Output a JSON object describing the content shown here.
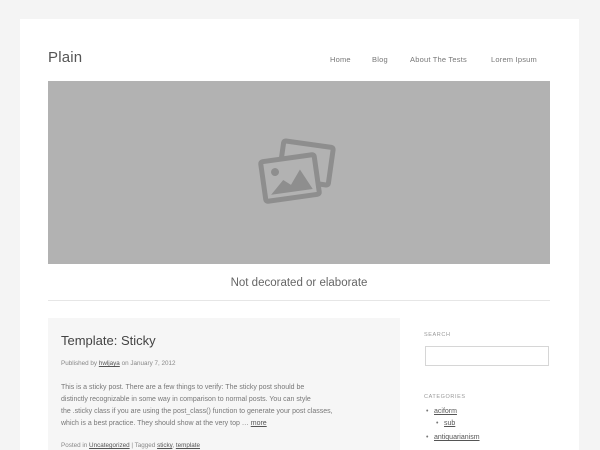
{
  "site": {
    "title": "Plain"
  },
  "nav": {
    "items": [
      "Home",
      "Blog",
      "About The Tests",
      "Lorem Ipsum"
    ]
  },
  "hero": {
    "icon": "image-placeholder-icon"
  },
  "tagline": "Not decorated or elaborate",
  "post": {
    "title": "Template: Sticky",
    "meta_prefix": "Published by",
    "author": "hwljaya",
    "meta_on": "on",
    "date": "January 7, 2012",
    "excerpt_lines": [
      "This is a sticky post. There are a few things to verify: The sticky post should be",
      "distinctly recognizable in some way in comparison to normal posts. You can style",
      "the .sticky class if you are using the post_class() function to generate your post classes,",
      "which is a best practice. They should show at the very top …"
    ],
    "more_label": "more",
    "footer_posted_in": "Posted in",
    "category": "Uncategorized",
    "footer_tagged": "| Tagged",
    "tags": [
      "sticky",
      "template"
    ]
  },
  "sidebar": {
    "search_title": "SEARCH",
    "search_placeholder": "",
    "categories_title": "CATEGORIES",
    "categories": [
      "aciform",
      "sub",
      "antiquarianism"
    ]
  },
  "colors": {
    "background": "#f4f4f4",
    "hero": "#b2b2b2",
    "post_bg": "#f6f6f6"
  }
}
